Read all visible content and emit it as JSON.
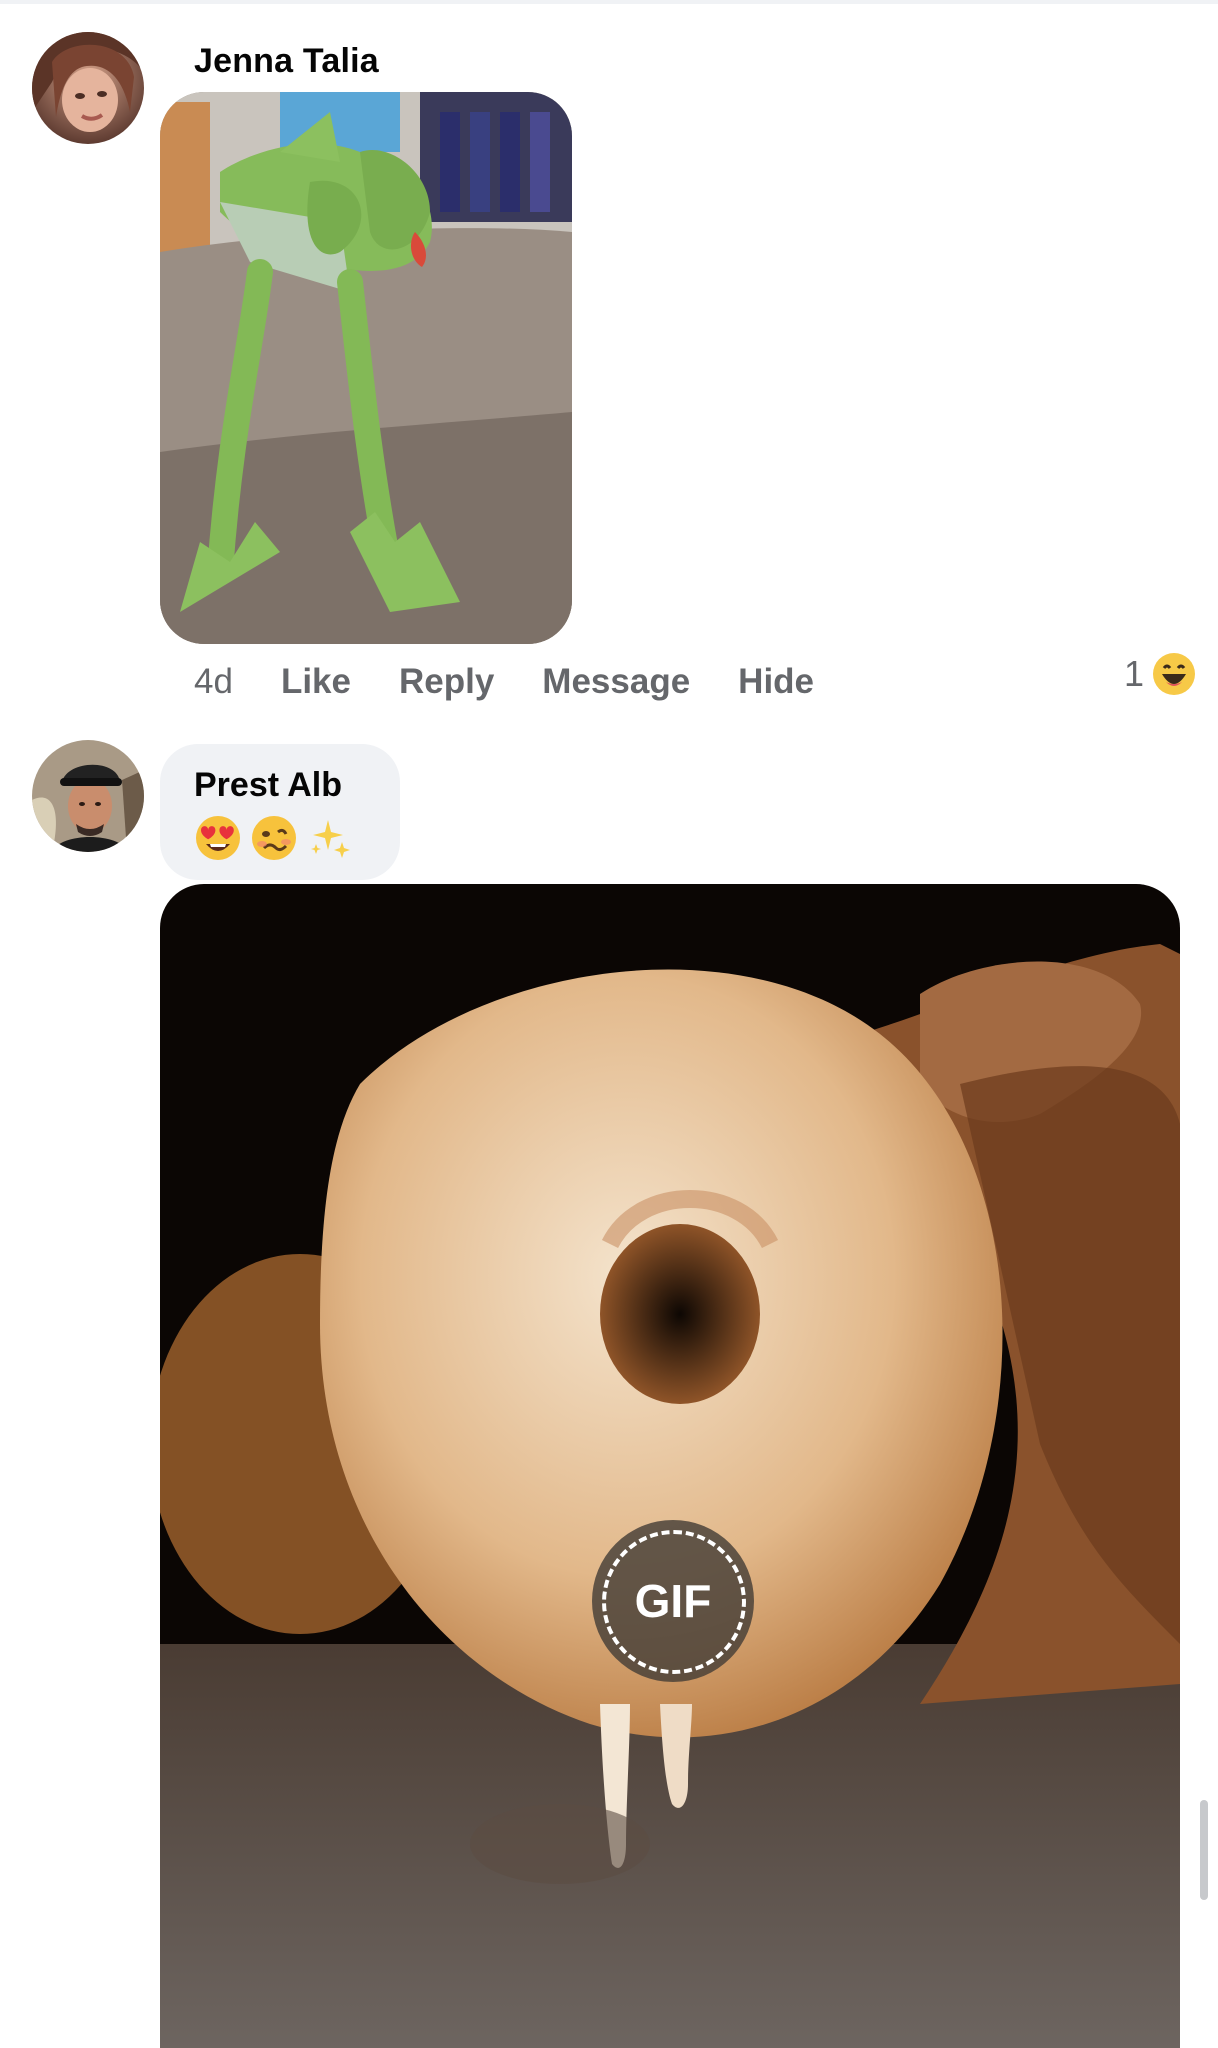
{
  "comments": [
    {
      "author": "Jenna Talia",
      "avatar_icon": "user-avatar",
      "attachment": "image",
      "actions": {
        "time": "4d",
        "like": "Like",
        "reply": "Reply",
        "message": "Message",
        "hide": "Hide"
      },
      "reaction": {
        "count": "1",
        "icon": "haha-reaction-icon"
      }
    },
    {
      "author": "Prest Alb",
      "avatar_icon": "user-avatar",
      "text_emojis": [
        "heart-eyes-emoji-icon",
        "woozy-face-emoji-icon",
        "sparkles-emoji-icon"
      ],
      "attachment": "gif",
      "gif_badge": "GIF"
    }
  ],
  "colors": {
    "meta_gray": "#65676b",
    "bubble_bg": "#f0f2f5",
    "name": "#050505"
  }
}
